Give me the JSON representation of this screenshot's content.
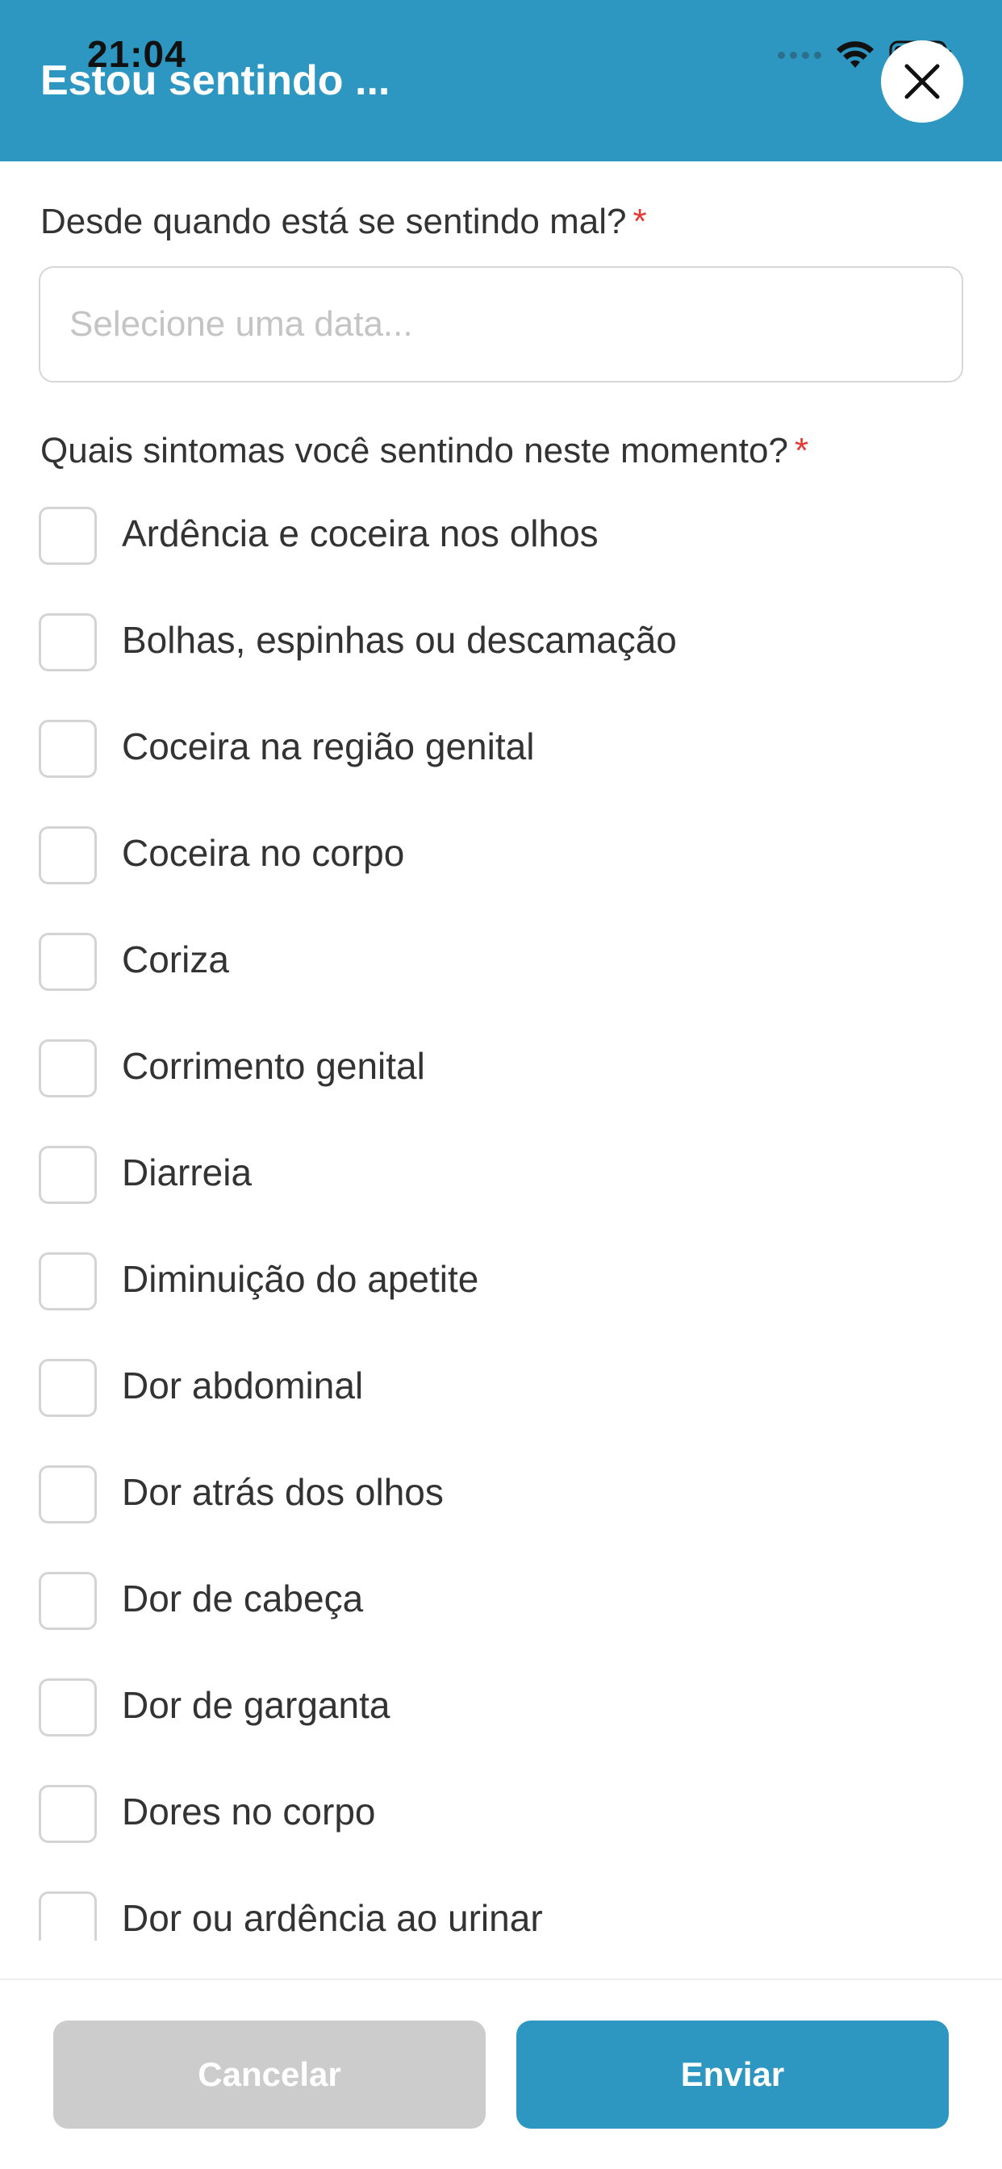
{
  "status_bar": {
    "time": "21:04",
    "icons": [
      "signal-dots-icon",
      "wifi-icon",
      "battery-icon"
    ]
  },
  "header": {
    "title": "Estou sentindo ...",
    "close_icon": "close-icon",
    "background_color": "#2e97c1"
  },
  "form": {
    "since_label": "Desde quando está se sentindo mal?",
    "required_mark": "*",
    "date_placeholder": "Selecione uma data...",
    "date_value": "",
    "symptoms_label": "Quais sintomas você sentindo neste momento?",
    "symptoms": [
      {
        "label": "Ardência e coceira nos olhos",
        "checked": false
      },
      {
        "label": "Bolhas, espinhas ou descamação",
        "checked": false
      },
      {
        "label": "Coceira na região genital",
        "checked": false
      },
      {
        "label": "Coceira no corpo",
        "checked": false
      },
      {
        "label": "Coriza",
        "checked": false
      },
      {
        "label": "Corrimento genital",
        "checked": false
      },
      {
        "label": "Diarreia",
        "checked": false
      },
      {
        "label": "Diminuição do apetite",
        "checked": false
      },
      {
        "label": "Dor abdominal",
        "checked": false
      },
      {
        "label": "Dor atrás dos olhos",
        "checked": false
      },
      {
        "label": "Dor de cabeça",
        "checked": false
      },
      {
        "label": "Dor de garganta",
        "checked": false
      },
      {
        "label": "Dores no corpo",
        "checked": false
      },
      {
        "label": "Dor ou ardência ao urinar",
        "checked": false
      }
    ]
  },
  "footer": {
    "cancel_label": "Cancelar",
    "send_label": "Enviar",
    "cancel_color": "#cccccc",
    "send_color": "#2e97c1"
  },
  "colors": {
    "required": "#e53935",
    "text": "#333333"
  }
}
